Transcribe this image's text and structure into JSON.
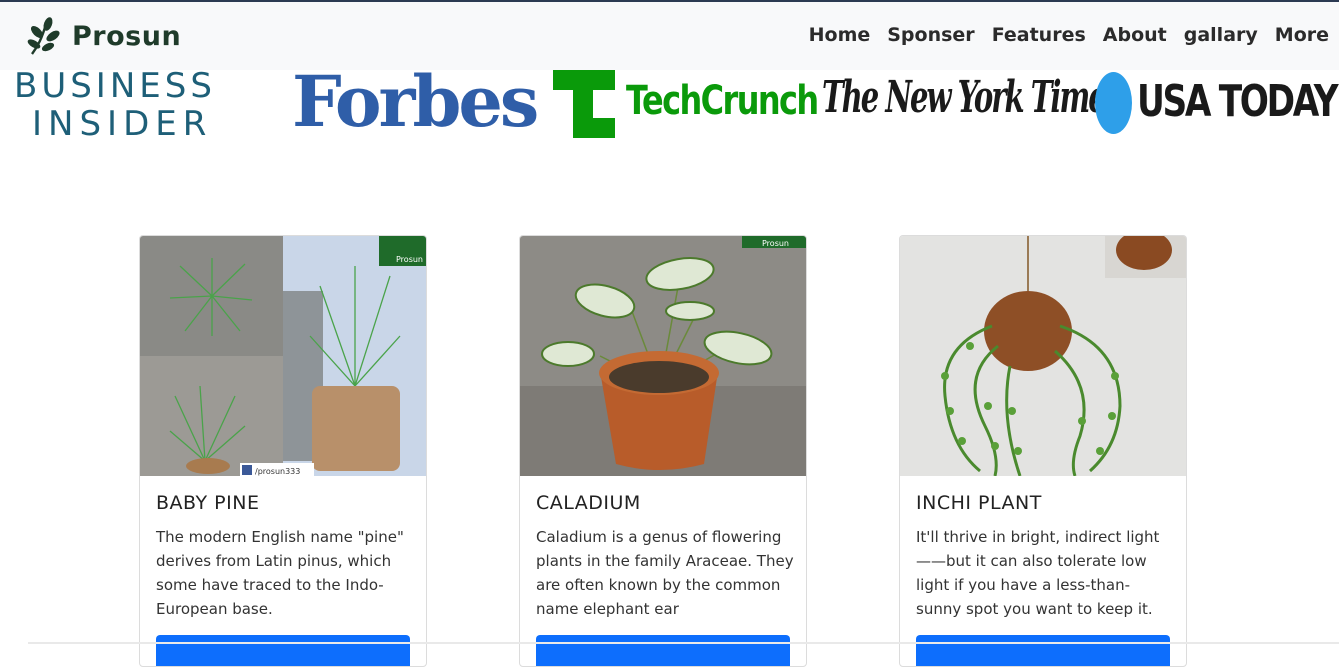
{
  "brand": {
    "name": "Prosun",
    "icon": "leaf-branch-icon",
    "color": "#1f3b2a"
  },
  "nav": {
    "items": [
      "Home",
      "Sponser",
      "Features",
      "About",
      "gallary",
      "More"
    ]
  },
  "press": {
    "business_insider": {
      "line1": "BUSINESS",
      "line2": "INSIDER"
    },
    "forbes": "Forbes",
    "techcrunch": "TechCrunch",
    "nyt": "The New York Times",
    "usa_today": "USA TODAY"
  },
  "cards": [
    {
      "title": "BABY PINE",
      "text": "The modern English name \"pine\" derives from Latin pinus, which some have traced to the Indo-European base.",
      "watermark": "Prosun",
      "caption": "/prosun333",
      "button": ""
    },
    {
      "title": "CALADIUM",
      "text": "Caladium is a genus of flowering plants in the family Araceae. They are often known by the common name elephant ear",
      "watermark": "Prosun",
      "button": ""
    },
    {
      "title": "INCHI PLANT",
      "text": "It'll thrive in bright, indirect light——but it can also tolerate low light if you have a less-than-sunny spot you want to keep it.",
      "button": ""
    }
  ],
  "colors": {
    "navbar_bg": "#f8f9fa",
    "button": "#0d6efd",
    "forbes": "#2f5ea8",
    "techcrunch": "#0a9a0a",
    "usa_dot": "#2e9fe9"
  }
}
